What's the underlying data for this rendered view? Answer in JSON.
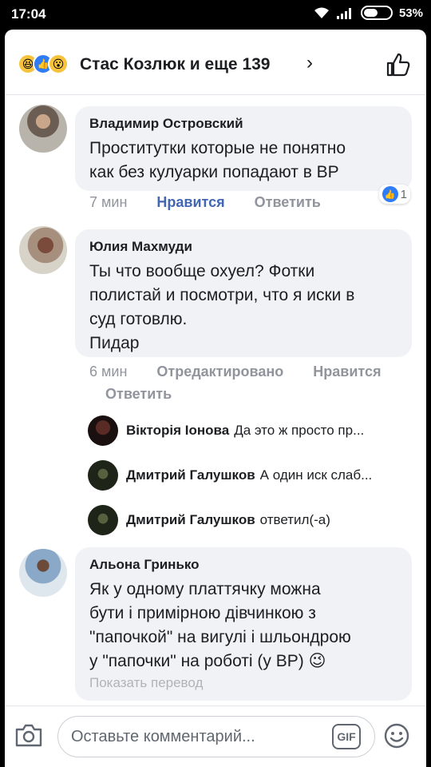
{
  "status": {
    "time": "17:04",
    "battery": "53%",
    "battery_fill": 0.53
  },
  "header": {
    "title": "Стас Козлюк и еще 139",
    "chevron": "›"
  },
  "comments": [
    {
      "author": "Владимир Островский",
      "text": "Проститутки которые не понятно\nкак без кулуарки попадают в ВР",
      "time": "7 мин",
      "like": "Нравится",
      "reply": "Ответить",
      "likes": "1"
    },
    {
      "author": "Юлия Махмуди",
      "text": "Ты что вообще охуел? Фотки\nполистай и посмотри, что я иски в\nсуд готовлю.\nПидар",
      "time": "6 мин",
      "edited": "Отредактировано",
      "like": "Нравится",
      "reply": "Ответить"
    },
    {
      "author": "Альона Гринько",
      "text": "Як у одному платтячку можна\nбути і примірною дівчинкою з\n\"папочкой\" на вигулі і шльондрою\nу \"папочки\" на роботі (у ВР) 😉",
      "translate": "Показать перевод"
    }
  ],
  "replies": [
    {
      "name": "Вікторія Іонова",
      "text": "Да это ж просто пр..."
    },
    {
      "name": "Дмитрий Галушков",
      "text": "А один иск слаб..."
    },
    {
      "name": "Дмитрий Галушков",
      "text": "ответил(-а)"
    }
  ],
  "composer": {
    "placeholder": "Оставьте комментарий...",
    "gif": "GIF"
  },
  "colors": {
    "accent": "#4267b2",
    "bubble": "#f0f2f5",
    "like_blue": "#2e7cf6"
  }
}
